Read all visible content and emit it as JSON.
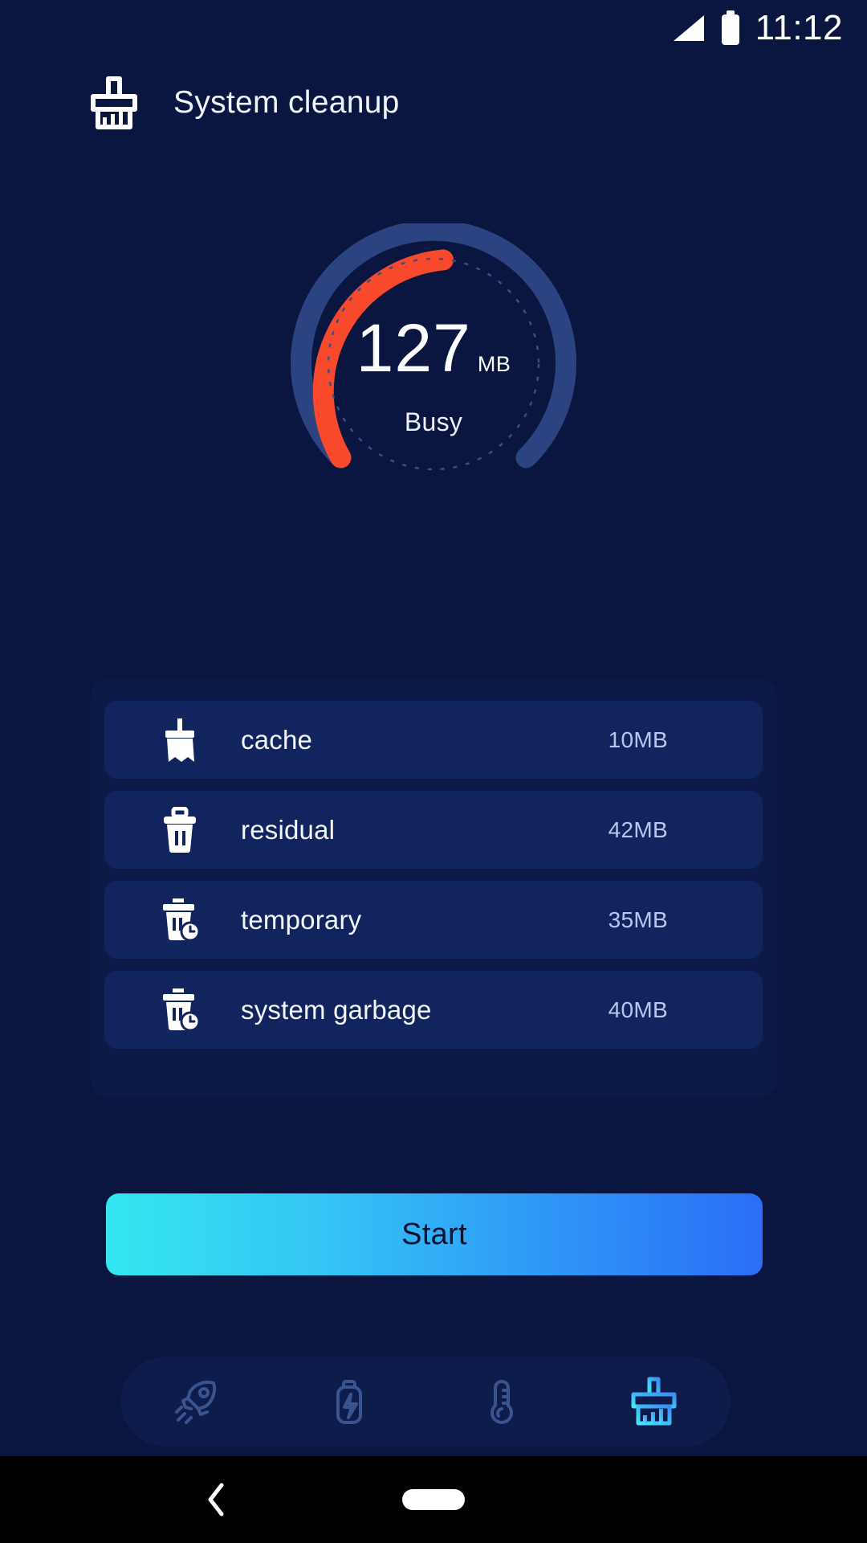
{
  "statusbar": {
    "time": "11:12",
    "signal_icon": "signal-triangle-icon",
    "battery_icon": "battery-full-icon"
  },
  "header": {
    "title": "System cleanup",
    "icon": "brush-icon"
  },
  "gauge": {
    "value": "127",
    "unit": "MB",
    "status": "Busy",
    "progress_color": "#f9492c",
    "track_color": "#2b4380",
    "percent": 58,
    "dotted_ring_color": "#3a4f86"
  },
  "items": [
    {
      "label": "cache",
      "value": "10MB",
      "icon": "broom-icon"
    },
    {
      "label": "residual",
      "value": "42MB",
      "icon": "trash-icon"
    },
    {
      "label": "temporary",
      "value": "35MB",
      "icon": "trash-clock-icon"
    },
    {
      "label": "system garbage",
      "value": "40MB",
      "icon": "trash-clock-icon"
    }
  ],
  "action": {
    "start_label": "Start",
    "gradient_from": "#33e6f0",
    "gradient_to": "#2a6ef6"
  },
  "bottomnav": {
    "items": [
      {
        "icon": "rocket-icon",
        "active": false
      },
      {
        "icon": "battery-bolt-icon",
        "active": false
      },
      {
        "icon": "thermometer-icon",
        "active": false
      },
      {
        "icon": "brush-icon",
        "active": true
      }
    ],
    "inactive_color": "#3a5490",
    "active_color": "#43e8f7"
  },
  "androidbar": {
    "back_icon": "back-chevron-icon",
    "home_icon": "home-pill-icon"
  },
  "theme": {
    "background": "#0a1640",
    "card": "#0c1a47",
    "row": "#12245e"
  }
}
